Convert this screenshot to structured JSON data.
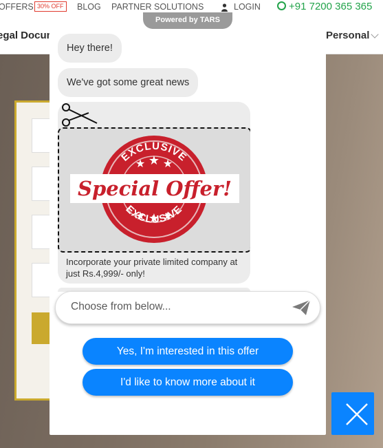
{
  "site": {
    "topbar": {
      "offers": "OFFERS",
      "offers_badge": "30% OFF",
      "blog": "BLOG",
      "partner": "PARTNER SOLUTIONS",
      "login": "LOGIN",
      "phone": "+91 7200 365 365"
    },
    "nav": {
      "left_item": "egal Docum",
      "right_item": "Personal"
    }
  },
  "chat": {
    "powered_by": "Powered by TARS",
    "messages": [
      "Hey there!",
      "We've got some great news"
    ],
    "offer_card": {
      "stamp_top": "EXCLUSIVE",
      "stamp_main": "Special Offer!",
      "stamp_bottom": "EXCLUSIVE",
      "caption": "Incorporate your private limited company at just Rs.4,999/- only!"
    },
    "input_placeholder": "Choose from below...",
    "options": [
      "Yes, I'm interested in this offer",
      "I'd like to know more about it"
    ]
  },
  "icons": {
    "send": "send-icon",
    "close": "close-icon",
    "scissors": "scissors-icon",
    "login": "user-icon",
    "phone": "whatsapp-icon"
  },
  "colors": {
    "accent_blue": "#0a84ff",
    "stamp_red": "#c8202c",
    "phone_green": "#22a34a",
    "form_gold": "#caa92e"
  }
}
